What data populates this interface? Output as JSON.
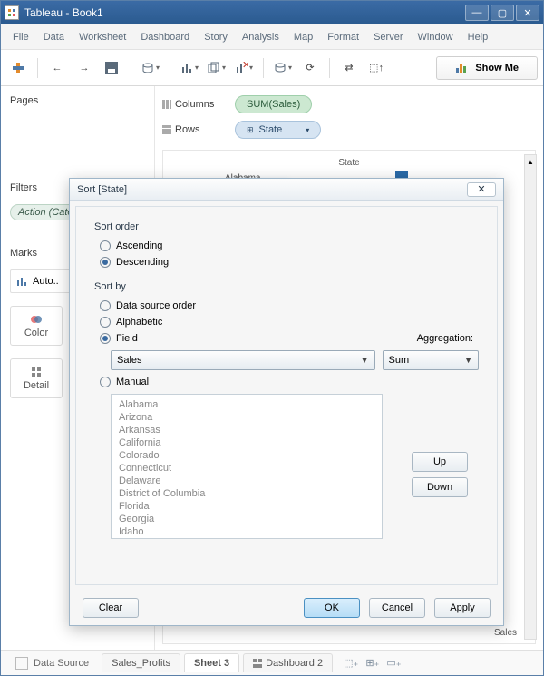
{
  "window": {
    "title": "Tableau - Book1"
  },
  "menu": [
    "File",
    "Data",
    "Worksheet",
    "Dashboard",
    "Story",
    "Analysis",
    "Map",
    "Format",
    "Server",
    "Window",
    "Help"
  ],
  "showme": "Show Me",
  "shelves": {
    "columns_label": "Columns",
    "rows_label": "Rows",
    "columns_pill": "SUM(Sales)",
    "rows_pill": "State"
  },
  "panels": {
    "pages": "Pages",
    "filters": "Filters",
    "marks": "Marks",
    "filter_pill": "Action (Category,Se..",
    "marks_type": "Auto..",
    "color": "Color",
    "detail": "Detail"
  },
  "viz": {
    "col_header": "State",
    "first_row": "Alabama",
    "x_axis": "Sales"
  },
  "tabs": {
    "data_source": "Data Source",
    "t1": "Sales_Profits",
    "t2": "Sheet 3",
    "t3": "Dashboard 2"
  },
  "modal": {
    "title": "Sort [State]",
    "sort_order": "Sort order",
    "ascending": "Ascending",
    "descending": "Descending",
    "sort_by": "Sort by",
    "dso": "Data source order",
    "alpha": "Alphabetic",
    "field": "Field",
    "aggregation": "Aggregation:",
    "field_value": "Sales",
    "agg_value": "Sum",
    "manual": "Manual",
    "list": [
      "Alabama",
      "Arizona",
      "Arkansas",
      "California",
      "Colorado",
      "Connecticut",
      "Delaware",
      "District of Columbia",
      "Florida",
      "Georgia",
      "Idaho"
    ],
    "up": "Up",
    "down": "Down",
    "clear": "Clear",
    "ok": "OK",
    "cancel": "Cancel",
    "apply": "Apply"
  }
}
